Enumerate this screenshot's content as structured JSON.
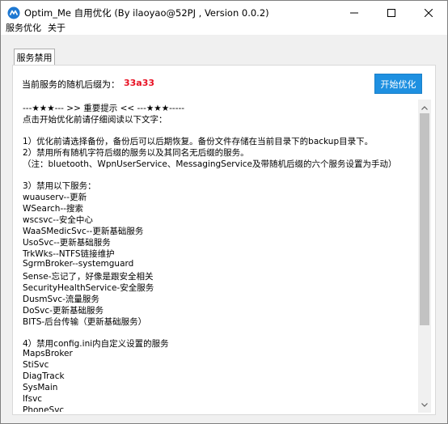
{
  "window": {
    "title": "Optim_Me 自用优化 (By ilaoyao@52PJ , Version 0.0.2)",
    "icon": "app-logo-icon",
    "accent_color": "#1e90e1"
  },
  "menu": [
    "服务优化",
    "关于"
  ],
  "tabs": [
    "服务禁用"
  ],
  "service": {
    "suffix_label": "当前服务的随机后缀为：",
    "suffix_value": "33a33",
    "suffix_color": "#e81123"
  },
  "buttons": {
    "optimize": "开始优化"
  },
  "notice_lines": [
    "---★★★--- >> 重要提示 << ---★★★-----",
    "点击开始优化前请仔细阅读以下文字：",
    "",
    "1）优化前请选择备份，备份后可以后期恢复。备份文件存储在当前目录下的backup目录下。",
    "2）禁用所有随机字符后缀的服务以及其同名无后缀的服务。",
    "  （注：bluetooth、WpnUserService、MessagingService及带随机后缀的六个服务设置为手动）",
    "",
    "3）禁用以下服务：",
    "  wuauserv--更新",
    "  WSearch--搜索",
    "  wscsvc--安全中心",
    "  WaaSMedicSvc--更新基础服务",
    "  UsoSvc--更新基础服务",
    "  TrkWks--NTFS链接维护",
    "  SgrmBroker--systemguard",
    "  Sense-忘记了，好像是跟安全相关",
    "  SecurityHealthService-安全服务",
    "  DusmSvc-流量服务",
    "  DoSvc-更新基础服务",
    "  BITS-后台传输（更新基础服务）",
    "",
    "4）禁用config.ini内自定义设置的服务",
    "  MapsBroker",
    "  StiSvc",
    "  DiagTrack",
    "  SysMain",
    "  lfsvc",
    "  PhoneSvc"
  ]
}
